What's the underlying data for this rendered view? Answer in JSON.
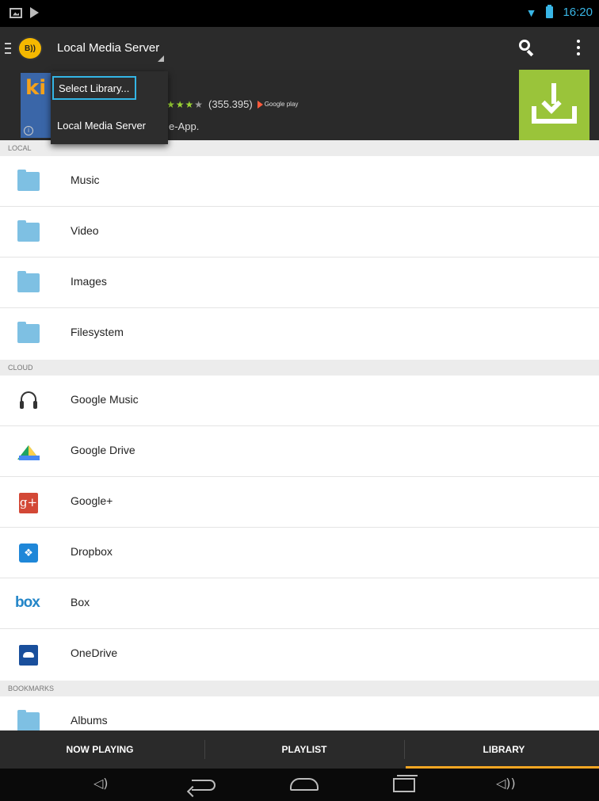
{
  "status_bar": {
    "time": "16:20",
    "accent_color": "#39b6e6"
  },
  "action_bar": {
    "logo_text": "B))",
    "title": "Local Media Server"
  },
  "ad": {
    "rating_count": "(355.395)",
    "store_label": "Google play",
    "thumb_text": "ki",
    "desc_fragment": "e-App."
  },
  "dropdown": {
    "items": [
      "Select Library...",
      "Local Media Server"
    ]
  },
  "sections": {
    "local": "LOCAL",
    "cloud": "CLOUD",
    "bookmarks": "BOOKMARKS"
  },
  "local_items": [
    "Music",
    "Video",
    "Images",
    "Filesystem"
  ],
  "cloud_items": [
    "Google Music",
    "Google Drive",
    "Google+",
    "Dropbox",
    "Box",
    "OneDrive"
  ],
  "bookmark_items": [
    "Albums"
  ],
  "cloud_icon_text": {
    "gplus": "g+",
    "box": "box"
  },
  "tabs": [
    "NOW PLAYING",
    "PLAYLIST",
    "LIBRARY"
  ],
  "active_tab_color": "#f5a623"
}
